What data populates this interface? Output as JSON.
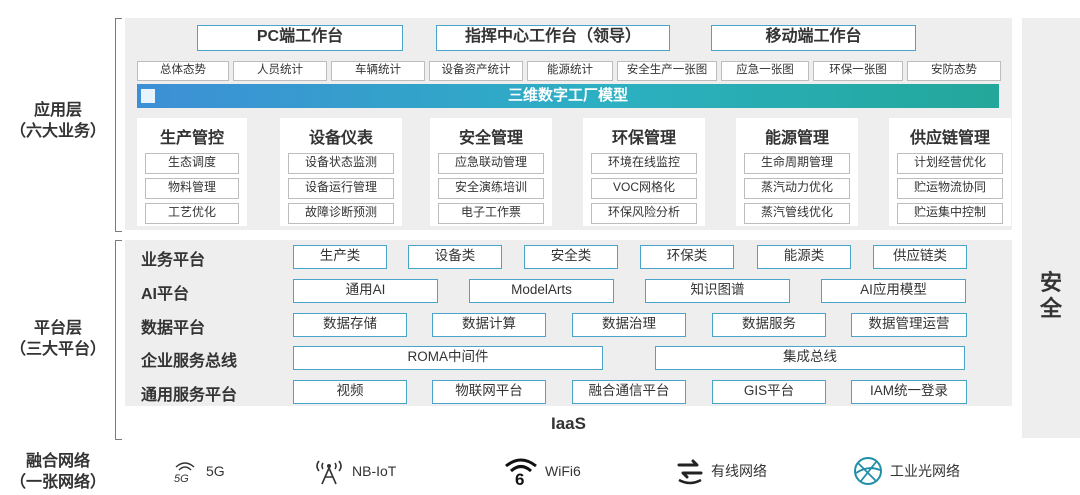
{
  "layers": {
    "app": {
      "line1": "应用层",
      "line2": "（六大业务）"
    },
    "platform": {
      "line1": "平台层",
      "line2": "（三大平台）"
    },
    "network": {
      "line1": "融合网络",
      "line2": "（一张网络）"
    }
  },
  "workstations": [
    "PC端工作台",
    "指挥中心工作台（领导）",
    "移动端工作台"
  ],
  "tags": [
    "总体态势",
    "人员统计",
    "车辆统计",
    "设备资产统计",
    "能源统计",
    "安全生产一张图",
    "应急一张图",
    "环保一张图",
    "安防态势"
  ],
  "model_bar": "三维数字工厂模型",
  "business_cards": [
    {
      "title": "生产管控",
      "items": [
        "生态调度",
        "物料管理",
        "工艺优化"
      ]
    },
    {
      "title": "设备仪表",
      "items": [
        "设备状态监测",
        "设备运行管理",
        "故障诊断预测"
      ]
    },
    {
      "title": "安全管理",
      "items": [
        "应急联动管理",
        "安全演练培训",
        "电子工作票"
      ]
    },
    {
      "title": "环保管理",
      "items": [
        "环境在线监控",
        "VOC网格化",
        "环保风险分析"
      ]
    },
    {
      "title": "能源管理",
      "items": [
        "生命周期管理",
        "蒸汽动力优化",
        "蒸汽管线优化"
      ]
    },
    {
      "title": "供应链管理",
      "items": [
        "计划经营优化",
        "贮运物流协同",
        "贮运集中控制"
      ]
    }
  ],
  "platform_rows": [
    {
      "label": "业务平台",
      "items": [
        "生产类",
        "设备类",
        "安全类",
        "环保类",
        "能源类",
        "供应链类"
      ]
    },
    {
      "label": "AI平台",
      "items": [
        "通用AI",
        "ModelArts",
        "知识图谱",
        "AI应用模型"
      ]
    },
    {
      "label": "数据平台",
      "items": [
        "数据存储",
        "数据计算",
        "数据治理",
        "数据服务",
        "数据管理运营"
      ]
    },
    {
      "label": "企业服务总线",
      "items": [
        "ROMA中间件",
        "集成总线"
      ]
    },
    {
      "label": "通用服务平台",
      "items": [
        "视频",
        "物联网平台",
        "融合通信平台",
        "GIS平台",
        "IAM统一登录"
      ]
    }
  ],
  "iaas": "IaaS",
  "network_items": [
    {
      "icon": "5g-icon",
      "label": "5G"
    },
    {
      "icon": "antenna-icon",
      "label": "NB-IoT"
    },
    {
      "icon": "wifi6-icon",
      "label": "WiFi6"
    },
    {
      "icon": "wired-network-icon",
      "label": "有线网络"
    },
    {
      "icon": "optical-network-icon",
      "label": "工业光网络"
    }
  ],
  "security": {
    "line1": "安",
    "line2": "全"
  },
  "colors": {
    "border_blue": "#4aa3c9",
    "panel_gray": "#eeeeee",
    "bar_start": "#3d8fd6",
    "bar_end": "#23a79a"
  }
}
